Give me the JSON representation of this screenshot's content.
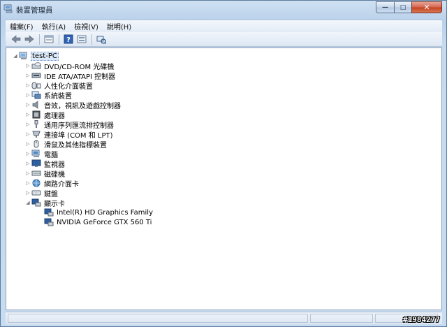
{
  "window": {
    "title": "裝置管理員",
    "buttons": {
      "minimize": "—",
      "maximize": "□",
      "close": "✕"
    }
  },
  "menu": [
    "檔案(F)",
    "執行(A)",
    "檢視(V)",
    "說明(H)"
  ],
  "toolbar": [
    "back-icon",
    "forward-icon",
    "properties-icon",
    "help-icon",
    "device-view-icon",
    "scan-hardware-icon"
  ],
  "tree": {
    "root": "test-PC",
    "categories": [
      {
        "label": "DVD/CD-ROM 光碟機",
        "icon": "dvd-drive-icon"
      },
      {
        "label": "IDE ATA/ATAPI 控制器",
        "icon": "ide-controller-icon"
      },
      {
        "label": "人性化介面裝置",
        "icon": "hid-icon"
      },
      {
        "label": "系統裝置",
        "icon": "system-device-icon"
      },
      {
        "label": "音效，視訊及遊戲控制器",
        "icon": "sound-icon"
      },
      {
        "label": "處理器",
        "icon": "processor-icon"
      },
      {
        "label": "通用序列匯流排控制器",
        "icon": "usb-icon"
      },
      {
        "label": "連接埠 (COM 和 LPT)",
        "icon": "port-icon"
      },
      {
        "label": "滑鼠及其他指標裝置",
        "icon": "mouse-icon"
      },
      {
        "label": "電腦",
        "icon": "computer-icon"
      },
      {
        "label": "監視器",
        "icon": "monitor-icon"
      },
      {
        "label": "磁碟機",
        "icon": "disk-drive-icon"
      },
      {
        "label": "網路介面卡",
        "icon": "network-adapter-icon"
      },
      {
        "label": "鍵盤",
        "icon": "keyboard-icon"
      },
      {
        "label": "顯示卡",
        "icon": "display-adapter-icon",
        "expanded": true
      }
    ],
    "display_children": [
      "Intel(R) HD Graphics Family",
      "NVIDIA GeForce GTX 560 Ti"
    ]
  },
  "watermark": "#1984277"
}
